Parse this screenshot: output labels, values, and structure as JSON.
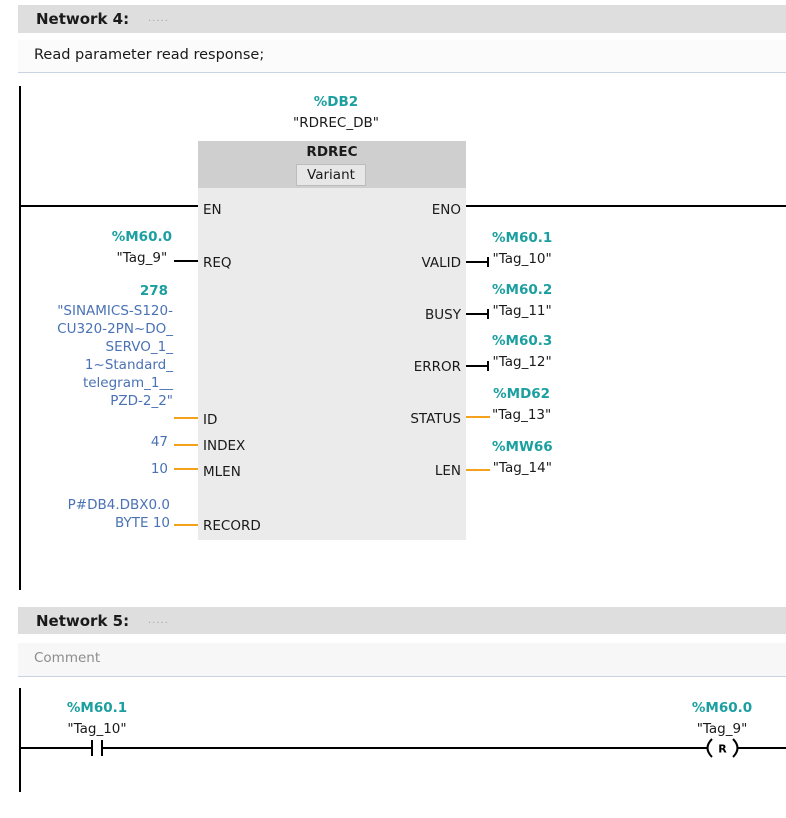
{
  "network4": {
    "title": "Network 4:",
    "title_placeholder": ".....",
    "comment": "Read parameter read response;",
    "block": {
      "instance_address": "%DB2",
      "instance_name": "\"RDREC_DB\"",
      "name": "RDREC",
      "data_type": "Variant",
      "en": "EN",
      "eno": "ENO",
      "inputs": {
        "req": {
          "pin": "REQ",
          "address": "%M60.0",
          "operand": "\"Tag_9\""
        },
        "id": {
          "pin": "ID",
          "address": "278",
          "operand_lines": [
            "\"SINAMICS-S120-",
            "CU320-2PN~DO_",
            "SERVO_1_",
            "1~Standard_",
            "telegram_1__",
            "PZD-2_2\""
          ]
        },
        "index": {
          "pin": "INDEX",
          "value": "47"
        },
        "mlen": {
          "pin": "MLEN",
          "value": "10"
        },
        "record": {
          "pin": "RECORD",
          "value_lines": [
            "P#DB4.DBX0.0",
            "BYTE 10"
          ]
        }
      },
      "outputs": {
        "valid": {
          "pin": "VALID",
          "address": "%M60.1",
          "operand": "\"Tag_10\""
        },
        "busy": {
          "pin": "BUSY",
          "address": "%M60.2",
          "operand": "\"Tag_11\""
        },
        "error": {
          "pin": "ERROR",
          "address": "%M60.3",
          "operand": "\"Tag_12\""
        },
        "status": {
          "pin": "STATUS",
          "address": "%MD62",
          "operand": "\"Tag_13\""
        },
        "len": {
          "pin": "LEN",
          "address": "%MW66",
          "operand": "\"Tag_14\""
        }
      }
    }
  },
  "network5": {
    "title": "Network 5:",
    "title_placeholder": ".....",
    "comment_placeholder": "Comment",
    "contact": {
      "symbol": "normally-open-contact",
      "address": "%M60.1",
      "operand": "\"Tag_10\""
    },
    "coil": {
      "symbol": "reset-coil",
      "type_label": "R",
      "address": "%M60.0",
      "operand": "\"Tag_9\""
    }
  },
  "colors": {
    "address": "#1c9fa0",
    "constant": "#4a72b5",
    "bool_wire": "#000000",
    "data_wire": "#f4a21c",
    "network_header_bg": "#dedede",
    "block_header_bg": "#cfcfcf",
    "block_body_bg": "#ebebeb",
    "comment_placeholder": "#8c8c8c"
  }
}
